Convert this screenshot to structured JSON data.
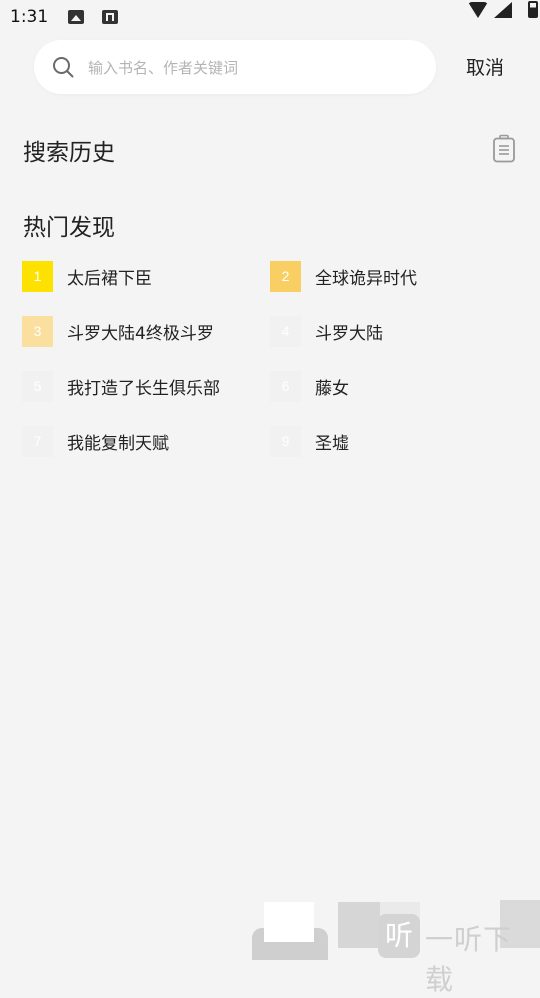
{
  "status_bar": {
    "time": "1:31",
    "icons": [
      "gallery-icon",
      "app-icon",
      "wifi-icon",
      "signal-icon",
      "battery-icon"
    ]
  },
  "search": {
    "placeholder": "输入书名、作者关键词",
    "value": "",
    "cancel_label": "取消"
  },
  "history": {
    "title": "搜索历史",
    "clear_icon": "trash-icon"
  },
  "hot": {
    "title": "热门发现",
    "items": [
      {
        "rank": "1",
        "title": "太后裙下臣",
        "badge_color": "#fde100"
      },
      {
        "rank": "2",
        "title": "全球诡异时代",
        "badge_color": "#f9cf63"
      },
      {
        "rank": "3",
        "title": "斗罗大陆4终极斗罗",
        "badge_color": "#fbdf9f"
      },
      {
        "rank": "4",
        "title": "斗罗大陆",
        "badge_color": "#f1f1f1"
      },
      {
        "rank": "5",
        "title": "我打造了长生俱乐部",
        "badge_color": "#f1f1f1"
      },
      {
        "rank": "6",
        "title": "藤女",
        "badge_color": "#f1f1f1"
      },
      {
        "rank": "7",
        "title": "我能复制天赋",
        "badge_color": "#f1f1f1"
      },
      {
        "rank": "9",
        "title": "圣墟",
        "badge_color": "#f1f1f1"
      }
    ]
  },
  "watermark": {
    "logo_char": "听",
    "text": "一听下载"
  },
  "colors": {
    "background": "#f4f4f4",
    "rank_1": "#fde100",
    "rank_2": "#f9cf63",
    "rank_3": "#fbdf9f",
    "rank_other": "#f1f1f1"
  }
}
